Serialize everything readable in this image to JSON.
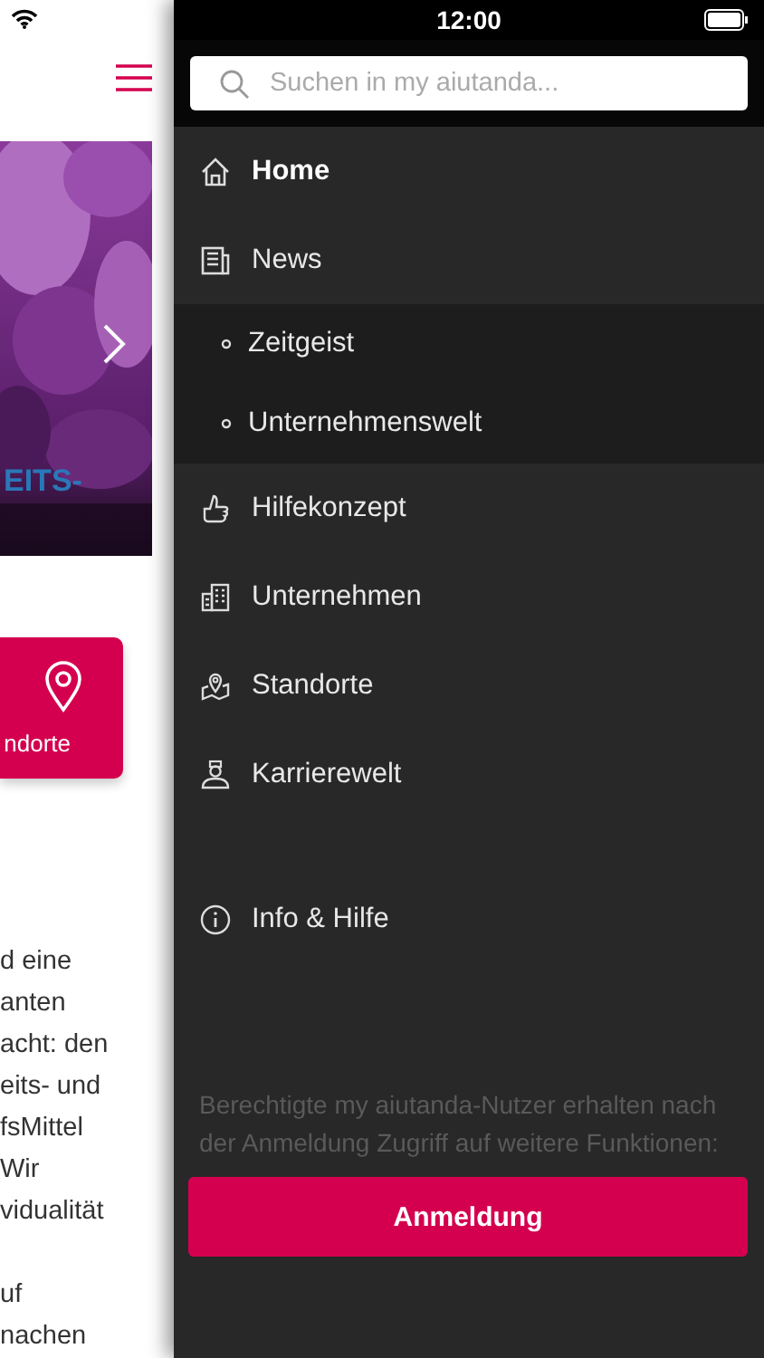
{
  "status_bar": {
    "time": "12:00"
  },
  "page": {
    "slider": {
      "kind": "picture",
      "caption": "EITS-"
    },
    "card": {
      "label": "ndorte"
    },
    "paragraphs": [
      [
        "d eine",
        "anten",
        "acht: den",
        "eits- und",
        "fsMittel",
        "Wir",
        "vidualität"
      ],
      [
        "uf",
        "nachen"
      ]
    ]
  },
  "drawer": {
    "search": {
      "placeholder": "Suchen in my aiutanda..."
    },
    "menu": [
      {
        "label": "Home",
        "selected": true
      },
      {
        "label": "News",
        "selected": false,
        "expanded": true,
        "children": [
          {
            "label": "Zeitgeist",
            "selected": false
          },
          {
            "label": "Unternehmenswelt",
            "selected": false
          }
        ]
      },
      {
        "label": "Hilfekonzept",
        "selected": false
      },
      {
        "label": "Unternehmen",
        "selected": false
      },
      {
        "label": "Standorte",
        "selected": false
      },
      {
        "label": "Karrierewelt",
        "selected": false
      }
    ],
    "info": {
      "label": "Info & Hilfe"
    },
    "notice": "Berechtigte my aiutanda-Nutzer erhalten nach der Anmeldung Zugriff auf weitere Funktionen:",
    "login_button": "Anmeldung"
  }
}
